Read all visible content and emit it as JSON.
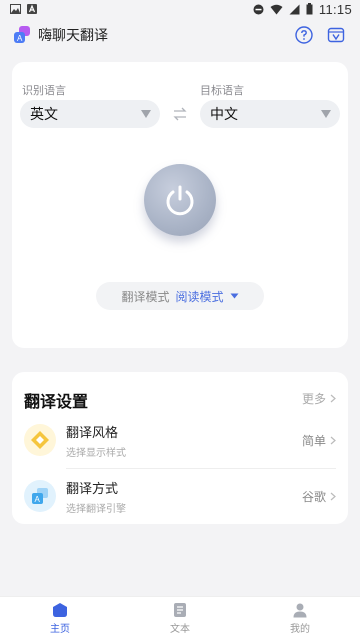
{
  "status": {
    "time": "11:15"
  },
  "app": {
    "title": "嗨聊天翻译"
  },
  "languages": {
    "source_label": "识别语言",
    "source_value": "英文",
    "target_label": "目标语言",
    "target_value": "中文"
  },
  "mode": {
    "label": "翻译模式",
    "value": "阅读模式"
  },
  "settings": {
    "title": "翻译设置",
    "more": "更多",
    "items": [
      {
        "title": "翻译风格",
        "subtitle": "选择显示样式",
        "value": "简单",
        "icon": "style-icon"
      },
      {
        "title": "翻译方式",
        "subtitle": "选择翻译引擎",
        "value": "谷歌",
        "icon": "translate-engine-icon"
      }
    ]
  },
  "nav": {
    "items": [
      {
        "label": "主页",
        "icon": "home-icon",
        "active": true
      },
      {
        "label": "文本",
        "icon": "document-icon",
        "active": false
      },
      {
        "label": "我的",
        "icon": "profile-icon",
        "active": false
      }
    ]
  },
  "colors": {
    "accent": "#3d63e0",
    "mode_value": "#4a6ee0",
    "background": "#f3f3f5"
  }
}
